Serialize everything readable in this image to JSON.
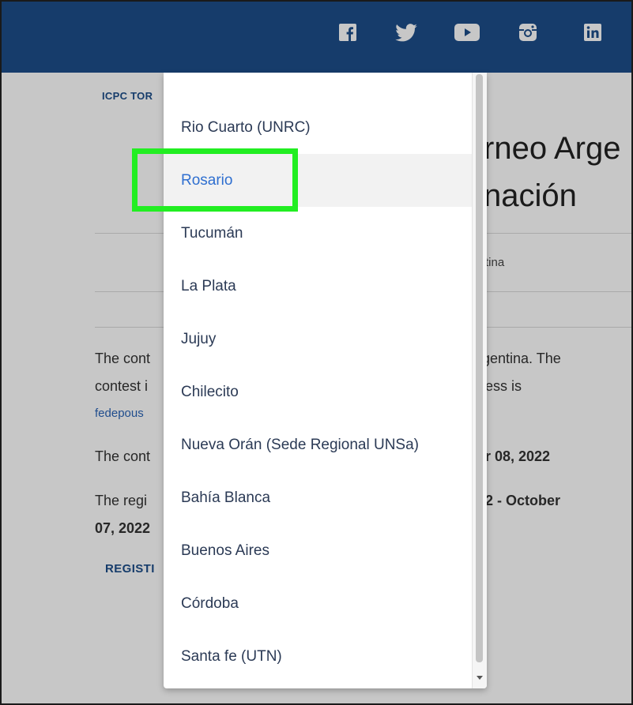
{
  "header": {
    "social_icons": [
      "facebook-icon",
      "twitter-icon",
      "youtube-icon",
      "instagram-icon",
      "linkedin-icon"
    ],
    "background": "#1d4e89"
  },
  "page": {
    "breadcrumb": "ICPC TOR",
    "title_line1": "rneo Arge",
    "title_line2": "nación",
    "location": "tina",
    "para1_line1_left": "The cont",
    "para1_line1_right": "gentina. The",
    "para1_line2_left": "contest i",
    "para1_line2_right": "ess is",
    "email_link": "fedepous",
    "date_line_left": "The cont",
    "date_line_right": "r 08, 2022",
    "reg_line1_left": "The regi",
    "reg_line1_right": "2 - October",
    "reg_line2": "07, 2022",
    "register_button": "REGISTI"
  },
  "dropdown": {
    "items": [
      "Rio Cuarto (UNRC)",
      "Rosario",
      "Tucumán",
      "La Plata",
      "Jujuy",
      "Chilecito",
      "Nueva Orán (Sede Regional UNSa)",
      "Bahía Blanca",
      "Buenos Aires",
      "Córdoba",
      "Santa fe (UTN)"
    ],
    "selected_index": 1,
    "highlight_color": "#22ee22"
  }
}
